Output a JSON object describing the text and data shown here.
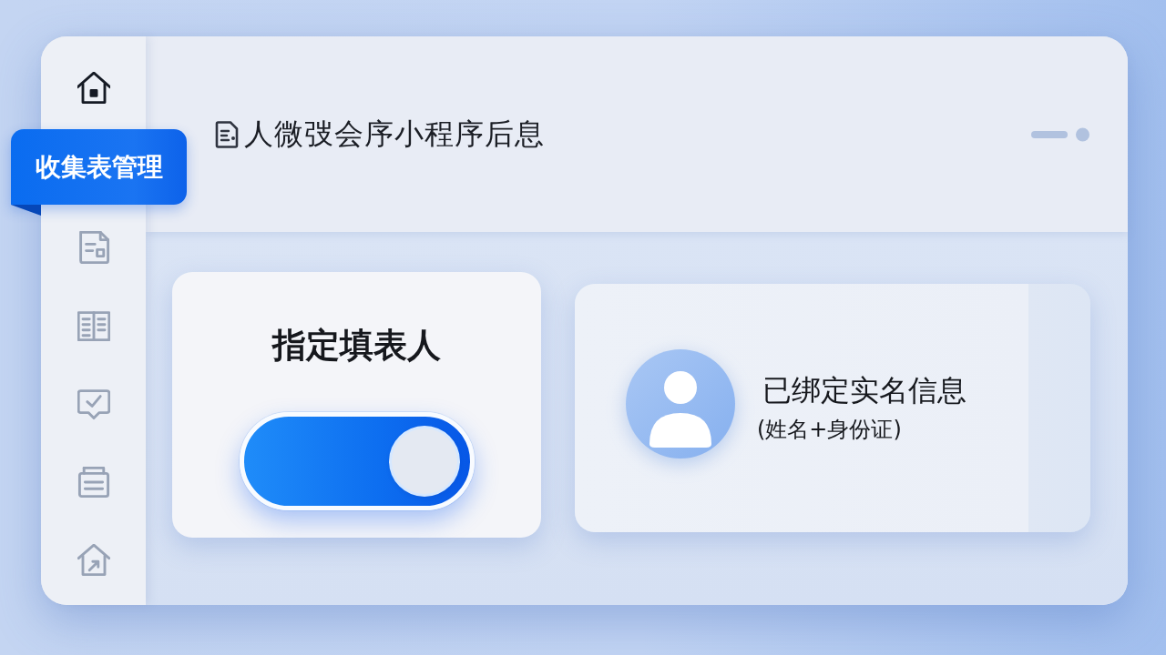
{
  "sidebar": {
    "items": [
      {
        "kind": "icon",
        "selected": false
      },
      {
        "kind": "label",
        "label": "收集表管理",
        "selected": true
      },
      {
        "kind": "icon",
        "selected": false
      },
      {
        "kind": "icon",
        "selected": false
      },
      {
        "kind": "icon",
        "selected": false
      },
      {
        "kind": "icon",
        "selected": false
      },
      {
        "kind": "icon",
        "selected": false
      }
    ]
  },
  "header": {
    "title": "人微弢会序小程序后息"
  },
  "cards": [
    {
      "kind": "switch",
      "title": "指定填表人",
      "toggle": {
        "on": true
      }
    },
    {
      "kind": "profile",
      "title": "已绑定实名信息",
      "subtitle": "(姓名+身份证)"
    }
  ]
}
